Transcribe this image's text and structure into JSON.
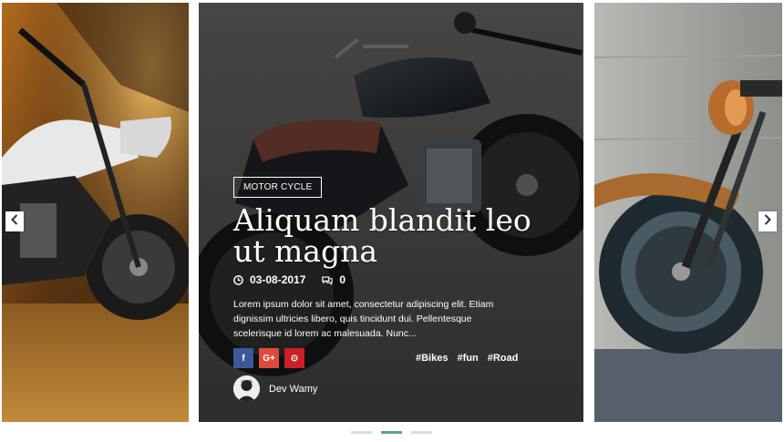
{
  "slides": [
    {
      "id": "left"
    },
    {
      "id": "center",
      "category": "MOTOR CYCLE",
      "title": "Aliquam blandit leo ut magna",
      "date": "03-08-2017",
      "comments": "0",
      "excerpt": "Lorem ipsum dolor sit amet, consectetur adipiscing elit. Etiam dignissim ultricies libero, quis tincidunt dui. Pellentesque scelerisque id lorem ac malesuada. Nunc...",
      "share": [
        {
          "network": "facebook",
          "glyph": "f"
        },
        {
          "network": "google-plus",
          "glyph": "G+"
        },
        {
          "network": "pinterest",
          "glyph": "⊙"
        }
      ],
      "tags": [
        "#Bikes",
        "#fun",
        "#Road"
      ],
      "author": "Dev Wamy"
    },
    {
      "id": "right"
    }
  ],
  "colors": {
    "facebook": "#3b5998",
    "google_plus": "#dd4b39",
    "pinterest": "#cb2027",
    "active_dot": "#5aa77a",
    "inactive_dot": "#dcdcdc"
  },
  "navigation": {
    "prev_icon": "chevron-left-icon",
    "next_icon": "chevron-right-icon"
  },
  "pagination": {
    "count": 3,
    "active_index": 1
  }
}
